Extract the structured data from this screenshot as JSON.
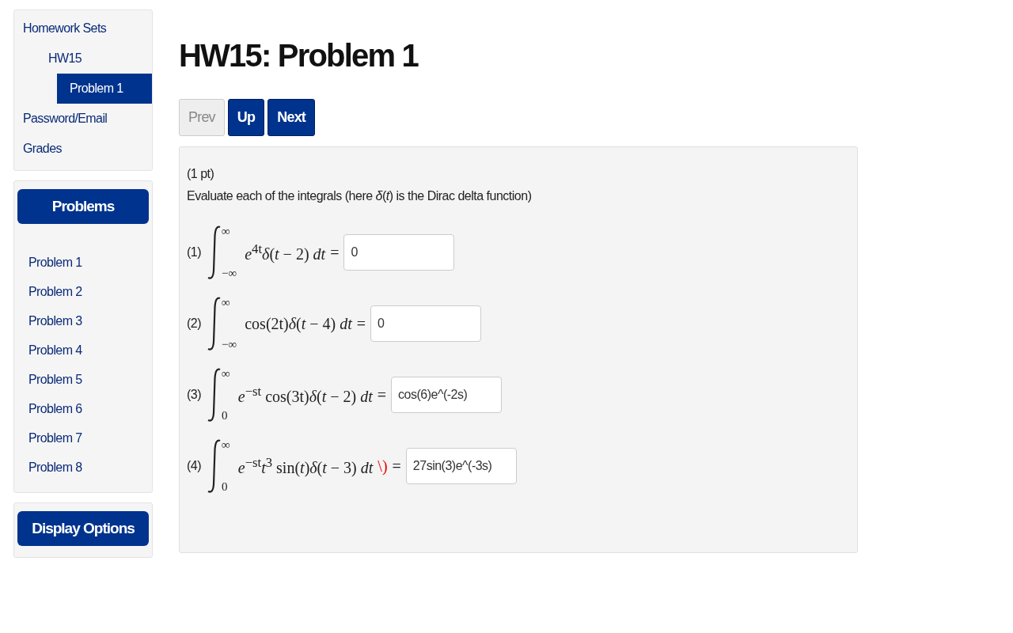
{
  "nav": {
    "items": [
      {
        "label": "Homework Sets",
        "selected": false,
        "children": [
          {
            "label": "HW15",
            "selected": false,
            "children": [
              {
                "label": "Problem 1",
                "selected": true
              }
            ]
          }
        ]
      },
      {
        "label": "Password/Email",
        "selected": false
      },
      {
        "label": "Grades",
        "selected": false
      }
    ]
  },
  "problems_panel": {
    "header": "Problems",
    "items": [
      {
        "label": "Problem 1"
      },
      {
        "label": "Problem 2"
      },
      {
        "label": "Problem 3"
      },
      {
        "label": "Problem 4"
      },
      {
        "label": "Problem 5"
      },
      {
        "label": "Problem 6"
      },
      {
        "label": "Problem 7"
      },
      {
        "label": "Problem 8"
      }
    ]
  },
  "display_options": {
    "label": "Display Options"
  },
  "title": "HW15: Problem 1",
  "buttons": [
    {
      "label": "Prev",
      "disabled": true
    },
    {
      "label": "Up",
      "disabled": false
    },
    {
      "label": "Next",
      "disabled": false
    }
  ],
  "problem": {
    "points": "(1 pt)",
    "prompt": "Evaluate each of the integrals (here *δ*(*t*) is the Dirac delta function)",
    "parts": [
      {
        "number": "(1)",
        "upper": "∞",
        "lower": "−∞",
        "integrand": "*e*$^{4t}$*δ*(*t* − 2) *dt*",
        "equals": "=",
        "answer": "0"
      },
      {
        "number": "(2)",
        "upper": "∞",
        "lower": "−∞",
        "integrand": "cos(2t)*δ*(*t* − 4) *dt*",
        "equals": "=",
        "answer": "0"
      },
      {
        "number": "(3)",
        "upper": "∞",
        "lower": "0",
        "integrand": "*e*$^{−st}$ cos(3t)*δ*(*t* − 2) *dt*",
        "equals": "=",
        "answer": "cos(6)e^(-2s)"
      },
      {
        "number": "(4)",
        "upper": "∞",
        "lower": "0",
        "integrand": "*e*$^{−st}$*t*$^{3}$ sin(*t*)*δ*(*t* − 3) *dt*",
        "error_mark": "\\)",
        "equals": "=",
        "answer": "27sin(3)e^(-3s)"
      }
    ]
  }
}
